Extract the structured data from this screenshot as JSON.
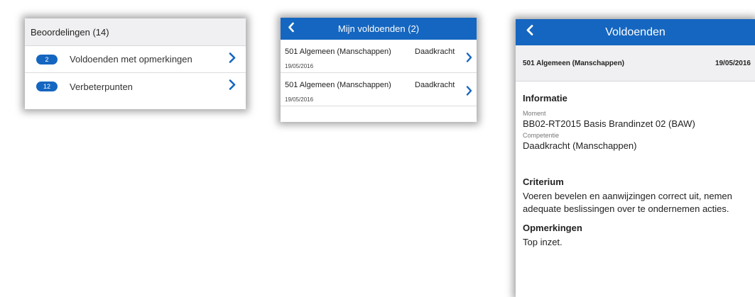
{
  "beoordelingen": {
    "header": "Beoordelingen (14)",
    "rows": [
      {
        "badge": "2",
        "label": "Voldoenden met opmerkingen"
      },
      {
        "badge": "12",
        "label": "Verbeterpunten"
      }
    ]
  },
  "voldoenden_list": {
    "title": "Mijn voldoenden (2)",
    "items": [
      {
        "org": "501 Algemeen (Manschappen)",
        "competence": "Daadkracht",
        "date": "19/05/2016"
      },
      {
        "org": "501 Algemeen (Manschappen)",
        "competence": "Daadkracht",
        "date": "19/05/2016"
      }
    ]
  },
  "detail": {
    "title": "Voldoenden",
    "org": "501 Algemeen (Manschappen)",
    "date": "19/05/2016",
    "informatie_heading": "Informatie",
    "moment_label": "Moment",
    "moment_value": "BB02-RT2015 Basis Brandinzet 02 (BAW)",
    "competentie_label": "Competentie",
    "competentie_value": "Daadkracht (Manschappen)",
    "criterium_heading": "Criterium",
    "criterium_text": "Voeren bevelen en aanwijzingen correct uit, nemen adequate beslissingen over te ondernemen acties.",
    "opmerkingen_heading": "Opmerkingen",
    "opmerkingen_text": "Top inzet."
  },
  "icons": {
    "chevron": "chevron-right-icon",
    "back": "chevron-left-icon"
  },
  "colors": {
    "accent": "#1566c0"
  }
}
